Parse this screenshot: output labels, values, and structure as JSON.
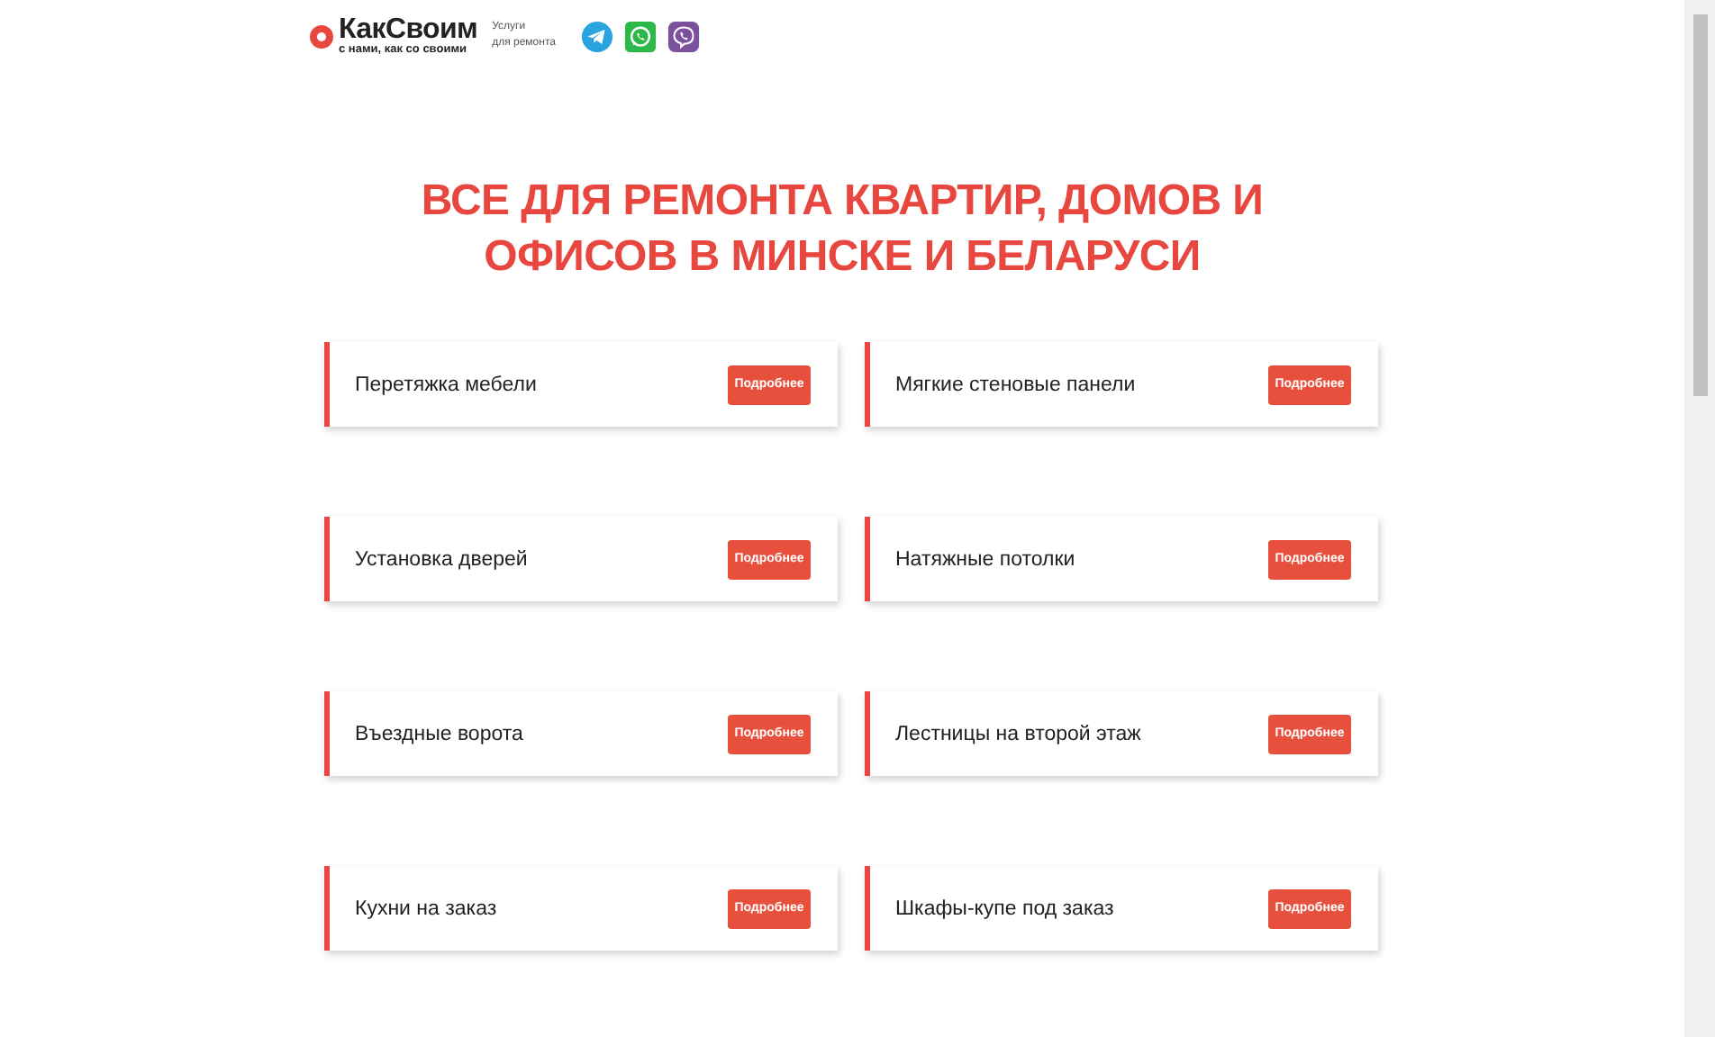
{
  "header": {
    "logo": {
      "name": "КакСвоим",
      "tagline": "с нами, как со своими"
    },
    "caption_lines": [
      "Услуги",
      "для ремонта"
    ],
    "messengers": [
      {
        "kind": "telegram"
      },
      {
        "kind": "whatsapp"
      },
      {
        "kind": "viber"
      }
    ]
  },
  "heading": "ВСЕ ДЛЯ РЕМОНТА КВАРТИР, ДОМОВ И ОФИСОВ В МИНСКЕ И БЕЛАРУСИ",
  "services": [
    {
      "title": "Перетяжка мебели",
      "button": "Подробнее"
    },
    {
      "title": "Мягкие стеновые панели",
      "button": "Подробнее"
    },
    {
      "title": "Установка дверей",
      "button": "Подробнее"
    },
    {
      "title": "Натяжные потолки",
      "button": "Подробнее"
    },
    {
      "title": "Въездные ворота",
      "button": "Подробнее"
    },
    {
      "title": "Лестницы на второй этаж",
      "button": "Подробнее"
    },
    {
      "title": "Кухни на заказ",
      "button": "Подробнее"
    },
    {
      "title": "Шкафы-купе под заказ",
      "button": "Подробнее"
    }
  ]
}
